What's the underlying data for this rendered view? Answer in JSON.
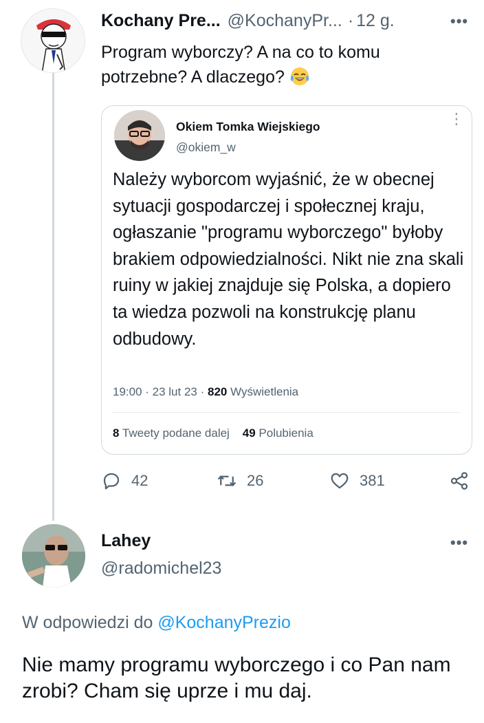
{
  "tweet": {
    "author_name": "Kochany Pre...",
    "author_handle": "@KochanyPr...",
    "separator": "·",
    "time": "12 g.",
    "text": "Program wyborczy? A na co to komu potrzebne? A dlaczego?",
    "emoji": "face-with-tears-of-joy",
    "more_label": "•••",
    "actions": {
      "replies": "42",
      "retweets": "26",
      "likes": "381"
    }
  },
  "quoted_tweet": {
    "author_name": "Okiem Tomka Wiejskiego",
    "author_handle": "@okiem_w",
    "more_label": "⋮",
    "text": "Należy wyborcom wyjaśnić, że w obecnej sytuacji gospodarczej i społecznej kraju, ogłaszanie \"programu wyborczego\" byłoby brakiem odpowiedzialności. Nikt nie zna skali ruiny w jakiej znajduje się Polska, a dopiero ta wiedza pozwoli na konstrukcję planu odbudowy.",
    "meta_prefix": "19:00 · 23 lut 23 · ",
    "views_count": "820",
    "views_label": " Wyświetlenia",
    "retweets_count": "8",
    "retweets_label": " Tweety podane dalej",
    "likes_count": "49",
    "likes_label": " Polubienia"
  },
  "reply": {
    "author_name": "Lahey",
    "author_handle": "@radomichel23",
    "more_label": "•••",
    "reply_prefix": "W odpowiedzi do ",
    "reply_mention": "@KochanyPrezio",
    "text": "Nie mamy programu wyborczego i co Pan nam zrobi? Cham się uprze i mu daj."
  },
  "colors": {
    "text_primary": "#0f1419",
    "text_secondary": "#536471",
    "accent": "#1d9bf0",
    "border": "#cfd9de"
  }
}
